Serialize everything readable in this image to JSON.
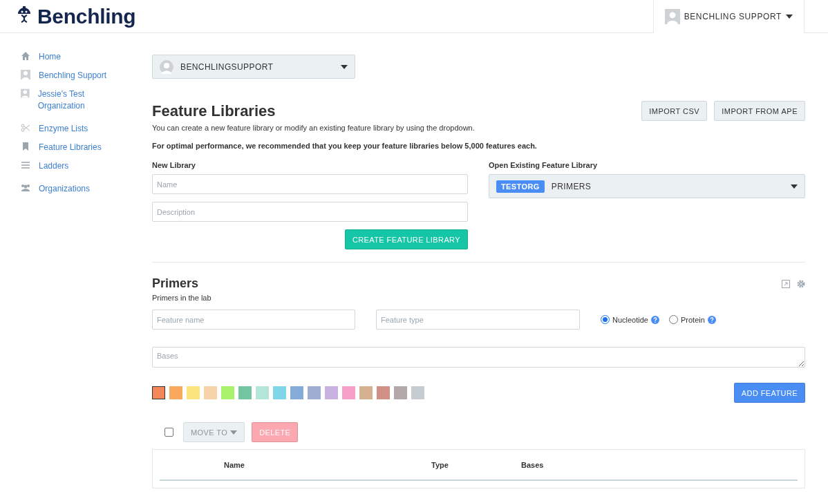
{
  "header": {
    "brand": "Benchling",
    "user": "BENCHLING SUPPORT"
  },
  "sidebar": {
    "groups": [
      [
        {
          "kind": "home",
          "label": "Home"
        },
        {
          "kind": "avatar",
          "label": "Benchling Support"
        },
        {
          "kind": "avatar",
          "label": "Jessie's Test Organization"
        }
      ],
      [
        {
          "kind": "scissors",
          "label": "Enzyme Lists"
        },
        {
          "kind": "bookmark",
          "label": "Feature Libraries"
        },
        {
          "kind": "list",
          "label": "Ladders"
        }
      ],
      [
        {
          "kind": "group",
          "label": "Organizations"
        }
      ]
    ]
  },
  "org_select": {
    "value": "BENCHLINGSUPPORT"
  },
  "page": {
    "title": "Feature Libraries",
    "buttons": [
      "IMPORT CSV",
      "IMPORT FROM APE"
    ],
    "description": "You can create a new feature library or modify an existing feature library by using the dropdown.",
    "note": "For optimal performance, we recommended that you keep your feature libraries below 5,000 features each."
  },
  "new_library": {
    "label": "New Library",
    "name_placeholder": "Name",
    "description_placeholder": "Description",
    "button": "CREATE FEATURE LIBRARY"
  },
  "open_library": {
    "label": "Open Existing Feature Library",
    "tag": "TESTORG",
    "value": "PRIMERS"
  },
  "library": {
    "title": "Primers",
    "subtitle": "Primers in the lab",
    "feature_name_placeholder": "Feature name",
    "feature_type_placeholder": "Feature type",
    "residue_types": [
      {
        "label": "Nucleotide",
        "selected": true
      },
      {
        "label": "Protein",
        "selected": false
      }
    ],
    "bases_placeholder": "Bases",
    "colors": [
      {
        "color": "#f4875a",
        "selected": true
      },
      {
        "color": "#f9a85d",
        "selected": false
      },
      {
        "color": "#fbe47c",
        "selected": false
      },
      {
        "color": "#f6d3a9",
        "selected": false
      },
      {
        "color": "#a9f36a",
        "selected": false
      },
      {
        "color": "#74c6a2",
        "selected": false
      },
      {
        "color": "#b4e6d8",
        "selected": false
      },
      {
        "color": "#7fd6e8",
        "selected": false
      },
      {
        "color": "#85acd8",
        "selected": false
      },
      {
        "color": "#9fadd3",
        "selected": false
      },
      {
        "color": "#c8b0e0",
        "selected": false
      },
      {
        "color": "#f79ec9",
        "selected": false
      },
      {
        "color": "#d4b08e",
        "selected": false
      },
      {
        "color": "#d28f86",
        "selected": false
      },
      {
        "color": "#b3a9aa",
        "selected": false
      },
      {
        "color": "#c7ccd3",
        "selected": false
      }
    ],
    "add_button": "ADD FEATURE",
    "select_all": {
      "checked": false
    },
    "move_to": "MOVE TO",
    "delete": "DELETE",
    "table": {
      "columns": [
        "Name",
        "Type",
        "Bases"
      ]
    }
  }
}
